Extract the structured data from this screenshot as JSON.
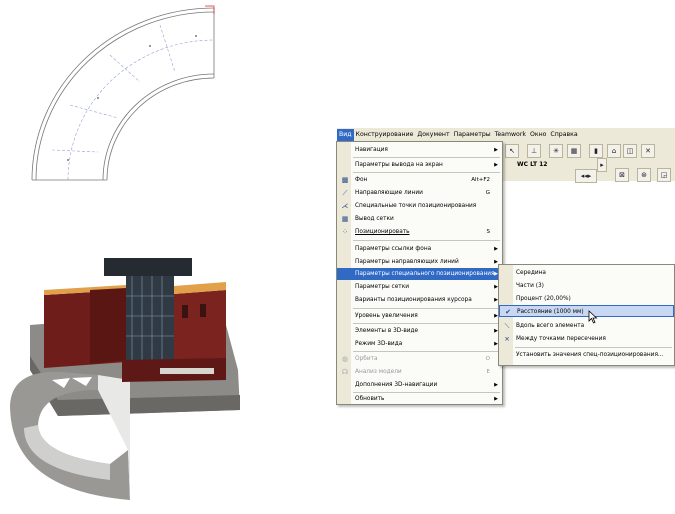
{
  "menubar": {
    "items": [
      "Вид",
      "Конструирование",
      "Документ",
      "Параметры",
      "Teamwork",
      "Окно",
      "Справка"
    ]
  },
  "toolbar": {
    "layer_label": "WC LT 12"
  },
  "view_menu": {
    "items": [
      {
        "label": "Навигация",
        "submenu": true
      },
      {
        "label": "Параметры вывода на экран",
        "submenu": true
      },
      {
        "label": "Фон",
        "shortcut": "Alt+F2"
      },
      {
        "label": "Направляющие линии",
        "shortcut": "G"
      },
      {
        "label": "Специальные точки позиционирования"
      },
      {
        "label": "Вывод сетки"
      },
      {
        "label": "Позиционировать",
        "shortcut": "S"
      },
      {
        "label": "Параметры ссылки фона",
        "submenu": true
      },
      {
        "label": "Параметры направляющих линий",
        "submenu": true
      },
      {
        "label": "Параметры специального позиционирования",
        "submenu": true
      },
      {
        "label": "Параметры сетки",
        "submenu": true
      },
      {
        "label": "Варианты позиционирования курсора",
        "submenu": true
      },
      {
        "label": "Уровень увеличения",
        "submenu": true
      },
      {
        "label": "Элементы в 3D-виде",
        "submenu": true
      },
      {
        "label": "Режим 3D-вида",
        "submenu": true
      },
      {
        "label": "Орбита",
        "shortcut": "O"
      },
      {
        "label": "Анализ модели",
        "shortcut": "E"
      },
      {
        "label": "Дополнения 3D-навигации",
        "submenu": true
      },
      {
        "label": "Обновить",
        "submenu": true
      }
    ]
  },
  "snap_submenu": {
    "items": [
      {
        "label": "Середина"
      },
      {
        "label": "Части (3)"
      },
      {
        "label": "Процент (20,00%)"
      },
      {
        "label": "Расстояние (1000 мм)",
        "checked": true
      },
      {
        "label": "Вдоль всего элемента"
      },
      {
        "label": "Между точками пересечения"
      },
      {
        "label": "Установить значения спец-позиционирования..."
      }
    ]
  },
  "colors": {
    "highlight": "#316ac5",
    "menu_bg": "#fbfbf8",
    "chrome": "#ece9d8",
    "brick": "#6e1d1a"
  }
}
